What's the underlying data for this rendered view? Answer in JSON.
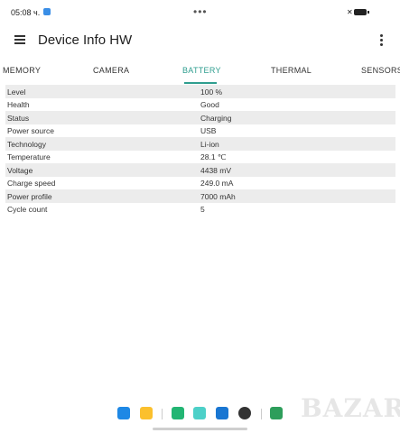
{
  "status_bar": {
    "time": "05:08 ч."
  },
  "app": {
    "title": "Device Info HW"
  },
  "tabs": [
    {
      "label": "MEMORY"
    },
    {
      "label": "CAMERA"
    },
    {
      "label": "BATTERY"
    },
    {
      "label": "THERMAL"
    },
    {
      "label": "SENSORS"
    }
  ],
  "active_tab": "BATTERY",
  "battery": {
    "rows": [
      {
        "key": "Level",
        "value": "100 %"
      },
      {
        "key": "Health",
        "value": "Good"
      },
      {
        "key": "Status",
        "value": "Charging"
      },
      {
        "key": "Power source",
        "value": "USB"
      },
      {
        "key": "Technology",
        "value": "Li-ion"
      },
      {
        "key": "Temperature",
        "value": "28.1 ℃"
      },
      {
        "key": "Voltage",
        "value": "4438 mV"
      },
      {
        "key": "Charge speed",
        "value": "249.0 mA"
      },
      {
        "key": "Power profile",
        "value": "7000 mAh"
      },
      {
        "key": "Cycle count",
        "value": "5"
      }
    ]
  },
  "watermark": "BAZAR",
  "colors": {
    "accent": "#2f9e8f",
    "row_alt": "#ececec"
  }
}
